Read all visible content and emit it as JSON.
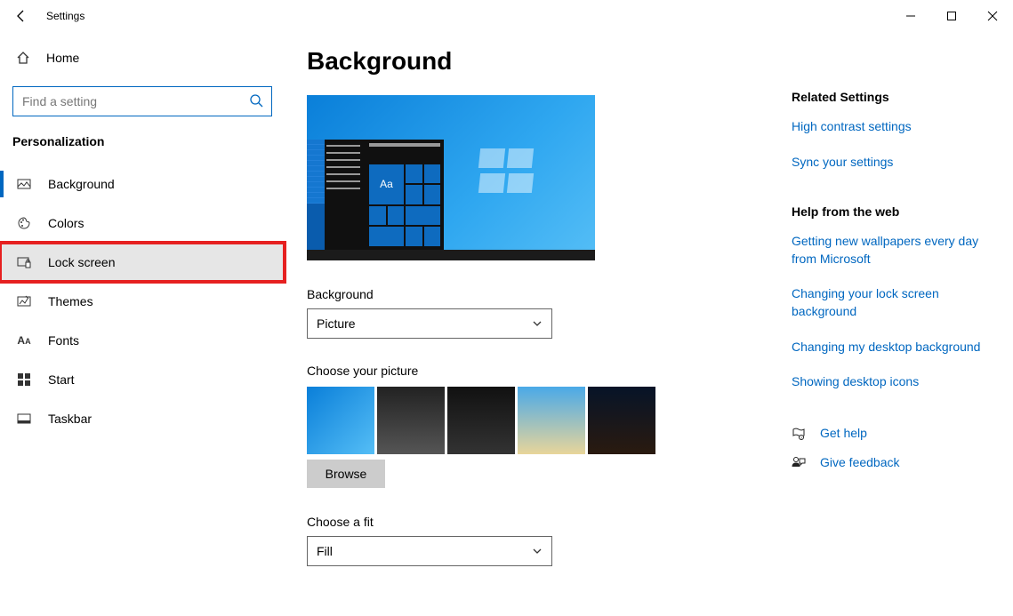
{
  "window": {
    "title": "Settings"
  },
  "sidebar": {
    "home": "Home",
    "search_placeholder": "Find a setting",
    "section": "Personalization",
    "items": [
      {
        "label": "Background"
      },
      {
        "label": "Colors"
      },
      {
        "label": "Lock screen"
      },
      {
        "label": "Themes"
      },
      {
        "label": "Fonts"
      },
      {
        "label": "Start"
      },
      {
        "label": "Taskbar"
      }
    ]
  },
  "main": {
    "heading": "Background",
    "preview_text": "Aa",
    "bg_label": "Background",
    "bg_value": "Picture",
    "choose_picture": "Choose your picture",
    "browse": "Browse",
    "fit_label": "Choose a fit",
    "fit_value": "Fill"
  },
  "right": {
    "related_head": "Related Settings",
    "related_links": [
      "High contrast settings",
      "Sync your settings"
    ],
    "help_head": "Help from the web",
    "help_links": [
      "Getting new wallpapers every day from Microsoft",
      "Changing your lock screen background",
      "Changing my desktop background",
      "Showing desktop icons"
    ],
    "get_help": "Get help",
    "feedback": "Give feedback"
  }
}
